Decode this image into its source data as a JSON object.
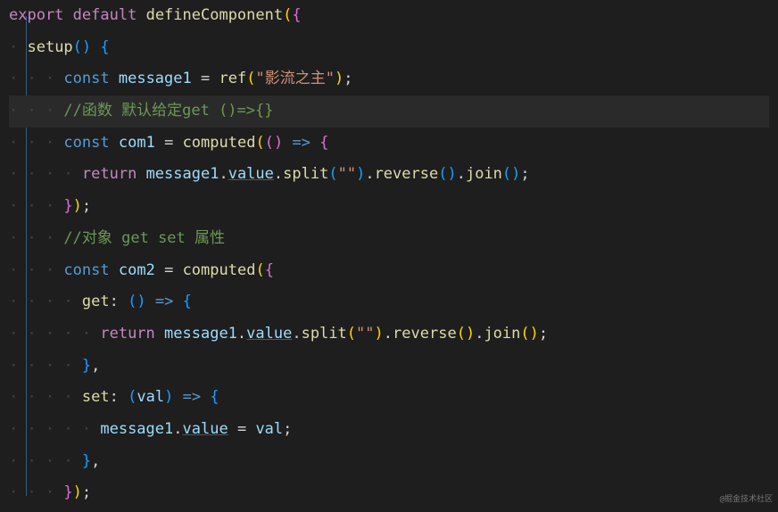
{
  "code": {
    "line1": {
      "export": "export",
      "default": "default",
      "defineComponent": "defineComponent"
    },
    "line2": {
      "setup": "setup",
      "parens": "()",
      "brace": "{"
    },
    "line3": {
      "const": "const",
      "var": "message1",
      "eq": "=",
      "fn": "ref",
      "str": "\"影流之主\""
    },
    "line4": {
      "comment": "//函数 默认给定get ()=>{}"
    },
    "line5": {
      "const": "const",
      "var": "com1",
      "eq": "=",
      "fn": "computed",
      "arrow": "=>"
    },
    "line6": {
      "return": "return",
      "var": "message1",
      "value": "value",
      "split": "split",
      "splitArg": "\"\"",
      "reverse": "reverse",
      "join": "join"
    },
    "line7": {
      "close": "});"
    },
    "line8": {
      "comment": "//对象 get set 属性"
    },
    "line9": {
      "const": "const",
      "var": "com2",
      "eq": "=",
      "fn": "computed"
    },
    "line10": {
      "get": "get",
      "arrow": "=>"
    },
    "line11": {
      "return": "return",
      "var": "message1",
      "value": "value",
      "split": "split",
      "splitArg": "\"\"",
      "reverse": "reverse",
      "join": "join"
    },
    "line12": {
      "close": "},"
    },
    "line13": {
      "set": "set",
      "val": "val",
      "arrow": "=>"
    },
    "line14": {
      "var": "message1",
      "value": "value",
      "eq": "=",
      "val": "val"
    },
    "line15": {
      "close": "},"
    },
    "line16": {
      "close": "});"
    }
  },
  "watermark": "@掘金技术社区"
}
